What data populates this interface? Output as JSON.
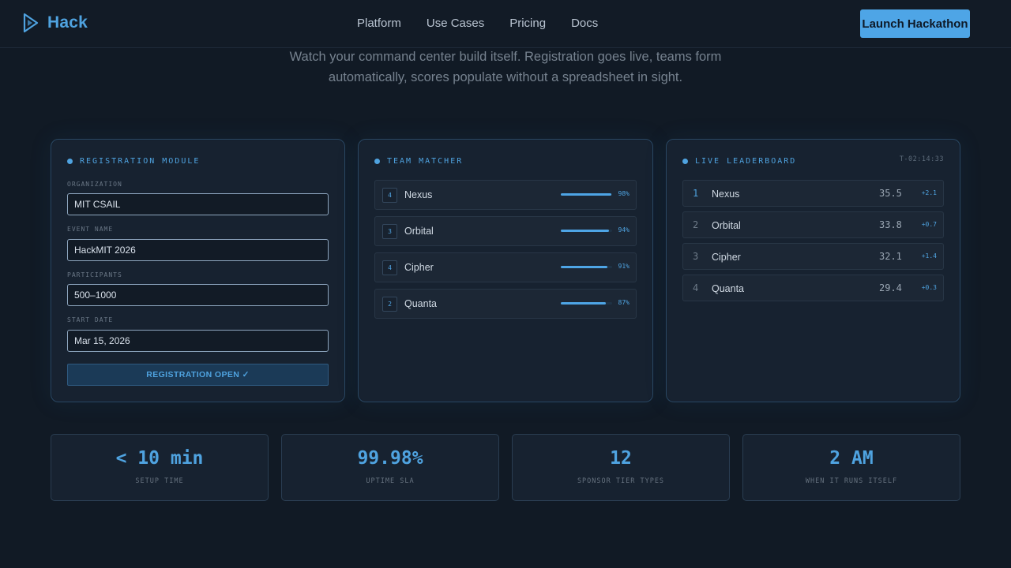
{
  "brand": {
    "name": "Hack",
    "icon": "play-logo-icon",
    "accent": "#4fa3e0"
  },
  "nav": {
    "links": [
      "Platform",
      "Use Cases",
      "Pricing",
      "Docs"
    ],
    "cta_label": "Launch Hackathon"
  },
  "hero": {
    "subtitle": "Watch your command center build itself. Registration goes live, teams form automatically, scores populate without a spreadsheet in sight."
  },
  "registration": {
    "title": "Registration Module",
    "fields": [
      {
        "label": "Organization",
        "value": "MIT CSAIL"
      },
      {
        "label": "Event Name",
        "value": "HackMIT 2026"
      },
      {
        "label": "Participants",
        "value": "500–1000"
      },
      {
        "label": "Start Date",
        "value": "Mar 15, 2026"
      }
    ],
    "button_label": "REGISTRATION OPEN ✓"
  },
  "team_matcher": {
    "title": "Team Matcher",
    "teams": [
      {
        "size": "4",
        "name": "Nexus",
        "match": 98,
        "match_label": "98%"
      },
      {
        "size": "3",
        "name": "Orbital",
        "match": 94,
        "match_label": "94%"
      },
      {
        "size": "4",
        "name": "Cipher",
        "match": 91,
        "match_label": "91%"
      },
      {
        "size": "2",
        "name": "Quanta",
        "match": 87,
        "match_label": "87%"
      }
    ]
  },
  "leaderboard": {
    "title": "Live Leaderboard",
    "timer": "T-02:14:33",
    "rows": [
      {
        "rank": "1",
        "name": "Nexus",
        "score": "35.5",
        "delta": "+2.1"
      },
      {
        "rank": "2",
        "name": "Orbital",
        "score": "33.8",
        "delta": "+0.7"
      },
      {
        "rank": "3",
        "name": "Cipher",
        "score": "32.1",
        "delta": "+1.4"
      },
      {
        "rank": "4",
        "name": "Quanta",
        "score": "29.4",
        "delta": "+0.3"
      }
    ]
  },
  "stats": [
    {
      "value": "< 10 min",
      "label": "Setup Time"
    },
    {
      "value": "99.98%",
      "label": "Uptime SLA"
    },
    {
      "value": "12",
      "label": "Sponsor Tier Types"
    },
    {
      "value": "2 AM",
      "label": "When It Runs Itself"
    }
  ]
}
